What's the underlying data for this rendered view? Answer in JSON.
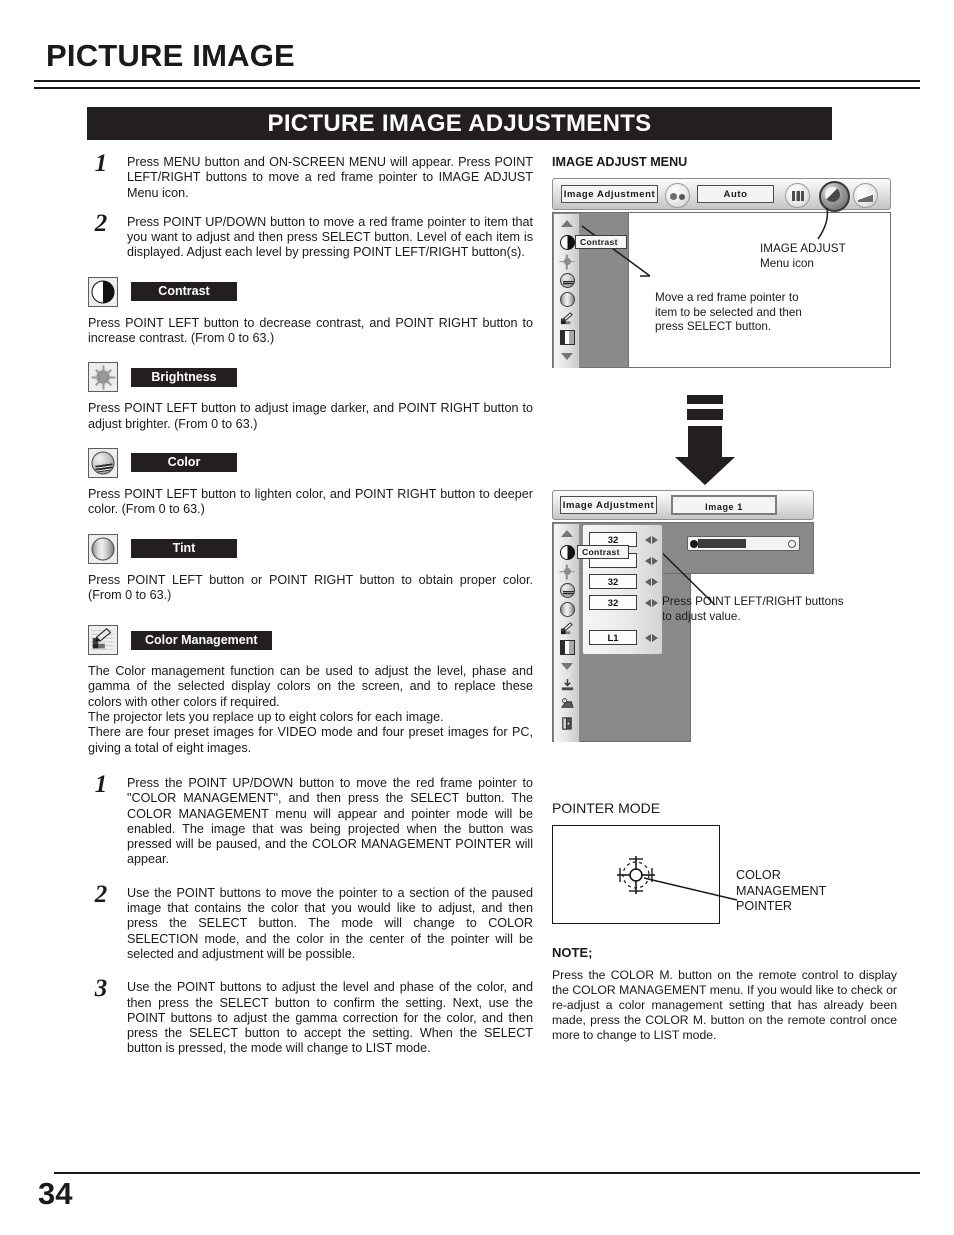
{
  "page": {
    "title": "PICTURE IMAGE",
    "banner": "PICTURE IMAGE ADJUSTMENTS",
    "number": "34"
  },
  "left": {
    "steps_top": [
      {
        "num": "1",
        "text": "Press MENU button and ON-SCREEN MENU will appear.  Press POINT LEFT/RIGHT buttons to move a red frame pointer to IMAGE ADJUST Menu icon."
      },
      {
        "num": "2",
        "text": "Press POINT UP/DOWN button to move a red frame pointer to item that you want to adjust and then press SELECT button.  Level of each item is displayed.  Adjust each level by pressing POINT LEFT/RIGHT button(s)."
      }
    ],
    "items": [
      {
        "icon": "contrast-icon",
        "label": "Contrast",
        "body": "Press POINT LEFT button to decrease contrast, and POINT RIGHT button to increase contrast.  (From 0 to 63.)"
      },
      {
        "icon": "brightness-icon",
        "label": "Brightness",
        "body": "Press POINT LEFT button to adjust image darker, and POINT RIGHT button to adjust brighter.  (From 0 to 63.)"
      },
      {
        "icon": "color-icon",
        "label": "Color",
        "body": "Press POINT LEFT button to lighten color, and POINT RIGHT button to deeper color.  (From 0 to 63.)"
      },
      {
        "icon": "tint-icon",
        "label": "Tint",
        "body": "Press POINT LEFT button or POINT RIGHT button to obtain proper color.  (From 0 to 63.)"
      }
    ],
    "color_management": {
      "icon": "color-management-icon",
      "label": "Color Management",
      "paragraphs": [
        "The Color management function can be used to adjust the level, phase and gamma of the selected display colors on the screen, and to replace these colors with other colors if required.",
        "The projector lets you replace up to eight colors for each image.",
        "There are four preset images for VIDEO mode and four preset images for PC, giving a total of eight images."
      ]
    },
    "steps_bottom": [
      {
        "num": "1",
        "text": "Press the POINT UP/DOWN button to move the red frame pointer to \"COLOR MANAGEMENT\", and then press the SELECT button. The COLOR MANAGEMENT menu will appear and pointer mode will be enabled. The image that was being projected when the button was pressed will be paused, and the COLOR MANAGEMENT POINTER will appear."
      },
      {
        "num": "2",
        "text": "Use the POINT buttons to move the pointer to a section of the paused image that contains the color that you would like to adjust, and then press the SELECT button. The mode will change to COLOR SELECTION mode, and the color in the center of the pointer will be selected and adjustment will be possible."
      },
      {
        "num": "3",
        "text": "Use the POINT buttons to adjust the level and phase of the color, and then press the SELECT button to confirm the setting. Next, use the POINT buttons to adjust the gamma correction for the color, and then press the SELECT button to accept the setting. When the SELECT button is pressed, the mode will change to LIST mode."
      }
    ]
  },
  "right": {
    "image_adjust_menu": {
      "caption": "IMAGE ADJUST MENU",
      "menu_name": "Image Adjustment",
      "auto_label": "Auto",
      "tooltip": "Contrast",
      "annotation_icon": "IMAGE ADJUST\nMenu icon",
      "annotation_icon_line1": "IMAGE ADJUST",
      "annotation_icon_line2": "Menu icon",
      "annotation_pointer_line1": "Move a red frame pointer to",
      "annotation_pointer_line2": "item to be selected and then",
      "annotation_pointer_line3": "press SELECT button."
    },
    "image_adjust_values": {
      "menu_name": "Image Adjustment",
      "image_label": "Image 1",
      "tooltip": "Contrast",
      "values": [
        "32",
        "",
        "32",
        "32",
        "L1"
      ],
      "annotation_line1": "Press POINT LEFT/RIGHT buttons",
      "annotation_line2": "to adjust value."
    },
    "pointer_mode": {
      "caption": "POINTER MODE",
      "annotation_line1": "COLOR",
      "annotation_line2": "MANAGEMENT",
      "annotation_line3": "POINTER"
    },
    "note": {
      "title": "NOTE;",
      "body": "Press the COLOR M. button on the remote control to display the COLOR MANAGEMENT menu. If you would like to check or re-adjust a color management setting that has already been made, press the COLOR M. button on the remote control once more to change to LIST mode."
    }
  },
  "colors": {
    "ink": "#1a1a1a",
    "banner_bg": "#231f20",
    "osd_gray": "#8a8a8a"
  }
}
